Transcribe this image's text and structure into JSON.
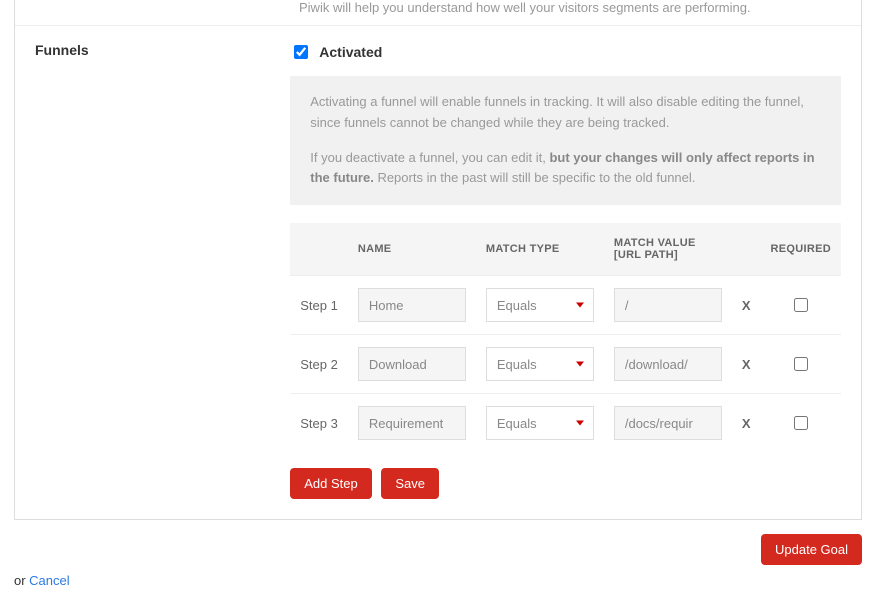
{
  "intro_text": "Piwik will help you understand how well your visitors segments are performing.",
  "section_label": "Funnels",
  "activated": {
    "checked": true,
    "label": "Activated"
  },
  "infobox": {
    "p1": "Activating a funnel will enable funnels in tracking. It will also disable editing the funnel, since funnels cannot be changed while they are being tracked.",
    "p2a": "If you deactivate a funnel, you can edit it, ",
    "p2b": "but your changes will only affect reports in the future.",
    "p2c": " Reports in the past will still be specific to the old funnel."
  },
  "table": {
    "headers": {
      "blank": "",
      "name": "NAME",
      "match_type": "MATCH TYPE",
      "match_value": "MATCH VALUE [URL PATH]",
      "required": "REQUIRED"
    },
    "rows": [
      {
        "step_label": "Step 1",
        "name": "Home",
        "match_type": "Equals",
        "match_value": "/",
        "remove": "X",
        "required": false
      },
      {
        "step_label": "Step 2",
        "name": "Download",
        "match_type": "Equals",
        "match_value": "/download/",
        "remove": "X",
        "required": false
      },
      {
        "step_label": "Step 3",
        "name": "Requirement",
        "match_type": "Equals",
        "match_value": "/docs/requir",
        "remove": "X",
        "required": false
      }
    ]
  },
  "buttons": {
    "add_step": "Add Step",
    "save": "Save",
    "update_goal": "Update Goal"
  },
  "footer": {
    "or": "or ",
    "cancel": "Cancel"
  }
}
